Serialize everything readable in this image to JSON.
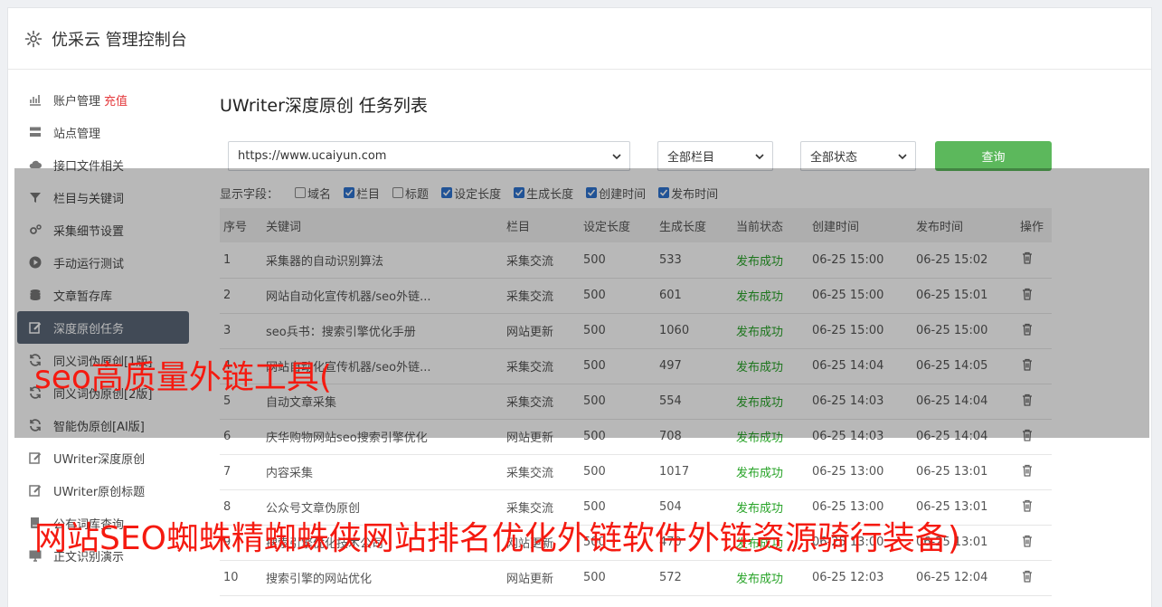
{
  "header": {
    "title": "优采云 管理控制台"
  },
  "sidebar": {
    "items": [
      {
        "label": "账户管理",
        "badge": "充值",
        "icon": "bar-chart-icon"
      },
      {
        "label": "站点管理",
        "icon": "server-icon"
      },
      {
        "label": "接口文件相关",
        "icon": "cloud-download-icon"
      },
      {
        "label": "栏目与关键词",
        "icon": "filter-icon"
      },
      {
        "label": "采集细节设置",
        "icon": "cogs-icon"
      },
      {
        "label": "手动运行测试",
        "icon": "play-circle-icon"
      },
      {
        "label": "文章暂存库",
        "icon": "database-icon"
      },
      {
        "label": "深度原创任务",
        "icon": "edit-icon",
        "active": true
      },
      {
        "label": "同义词伪原创[1版]",
        "icon": "refresh-icon"
      },
      {
        "label": "同义词伪原创[2版]",
        "icon": "refresh-icon"
      },
      {
        "label": "智能伪原创[AI版]",
        "icon": "refresh-icon"
      },
      {
        "label": "UWriter深度原创",
        "icon": "edit-icon"
      },
      {
        "label": "UWriter原创标题",
        "icon": "edit-icon"
      },
      {
        "label": "公有词库查询",
        "icon": "book-icon"
      },
      {
        "label": "正文识别演示",
        "icon": "desktop-icon"
      }
    ]
  },
  "main": {
    "title": "UWriter深度原创 任务列表",
    "site_select": "https://www.ucaiyun.com",
    "column_select": "全部栏目",
    "status_select": "全部状态",
    "query_button": "查询",
    "fields_label": "显示字段：",
    "fields": [
      {
        "label": "域名",
        "checked": false
      },
      {
        "label": "栏目",
        "checked": true
      },
      {
        "label": "标题",
        "checked": false
      },
      {
        "label": "设定长度",
        "checked": true
      },
      {
        "label": "生成长度",
        "checked": true
      },
      {
        "label": "创建时间",
        "checked": true
      },
      {
        "label": "发布时间",
        "checked": true
      }
    ]
  },
  "table": {
    "headers": [
      "序号",
      "关键词",
      "栏目",
      "设定长度",
      "生成长度",
      "当前状态",
      "创建时间",
      "发布时间",
      "操作"
    ],
    "rows": [
      [
        "1",
        "采集器的自动识别算法",
        "采集交流",
        "500",
        "533",
        "发布成功",
        "06-25 15:00",
        "06-25 15:02"
      ],
      [
        "2",
        "网站自动化宣传机器/seo外链...",
        "采集交流",
        "500",
        "601",
        "发布成功",
        "06-25 15:00",
        "06-25 15:01"
      ],
      [
        "3",
        "seo兵书：搜索引擎优化手册",
        "网站更新",
        "500",
        "1060",
        "发布成功",
        "06-25 15:00",
        "06-25 15:00"
      ],
      [
        "4",
        "网站自动化宣传机器/seo外链...",
        "采集交流",
        "500",
        "497",
        "发布成功",
        "06-25 14:04",
        "06-25 14:05"
      ],
      [
        "5",
        "自动文章采集",
        "采集交流",
        "500",
        "554",
        "发布成功",
        "06-25 14:03",
        "06-25 14:04"
      ],
      [
        "6",
        "庆华购物网站seo搜索引擎优化",
        "网站更新",
        "500",
        "708",
        "发布成功",
        "06-25 14:03",
        "06-25 14:04"
      ],
      [
        "7",
        "内容采集",
        "采集交流",
        "500",
        "1017",
        "发布成功",
        "06-25 13:00",
        "06-25 13:01"
      ],
      [
        "8",
        "公众号文章伪原创",
        "采集交流",
        "500",
        "504",
        "发布成功",
        "06-25 13:00",
        "06-25 13:01"
      ],
      [
        "9",
        "搜索引擎优化技术公司",
        "网站更新",
        "500",
        "470",
        "发布成功",
        "06-25 13:00",
        "06-25 13:01"
      ],
      [
        "10",
        "搜索引擎的网站优化",
        "网站更新",
        "500",
        "572",
        "发布成功",
        "06-25 12:03",
        "06-25 12:04"
      ]
    ]
  },
  "watermark": {
    "line1": "seo高质量外链工具(",
    "line2": "网站SEO蜘蛛精蜘蛛侠网站排名优化外链软件外链资源骑行装备)"
  },
  "colors": {
    "success": "#27a327",
    "primary_button": "#5cb85c",
    "active_nav": "#5a6778",
    "watermark": "#f51a10"
  }
}
